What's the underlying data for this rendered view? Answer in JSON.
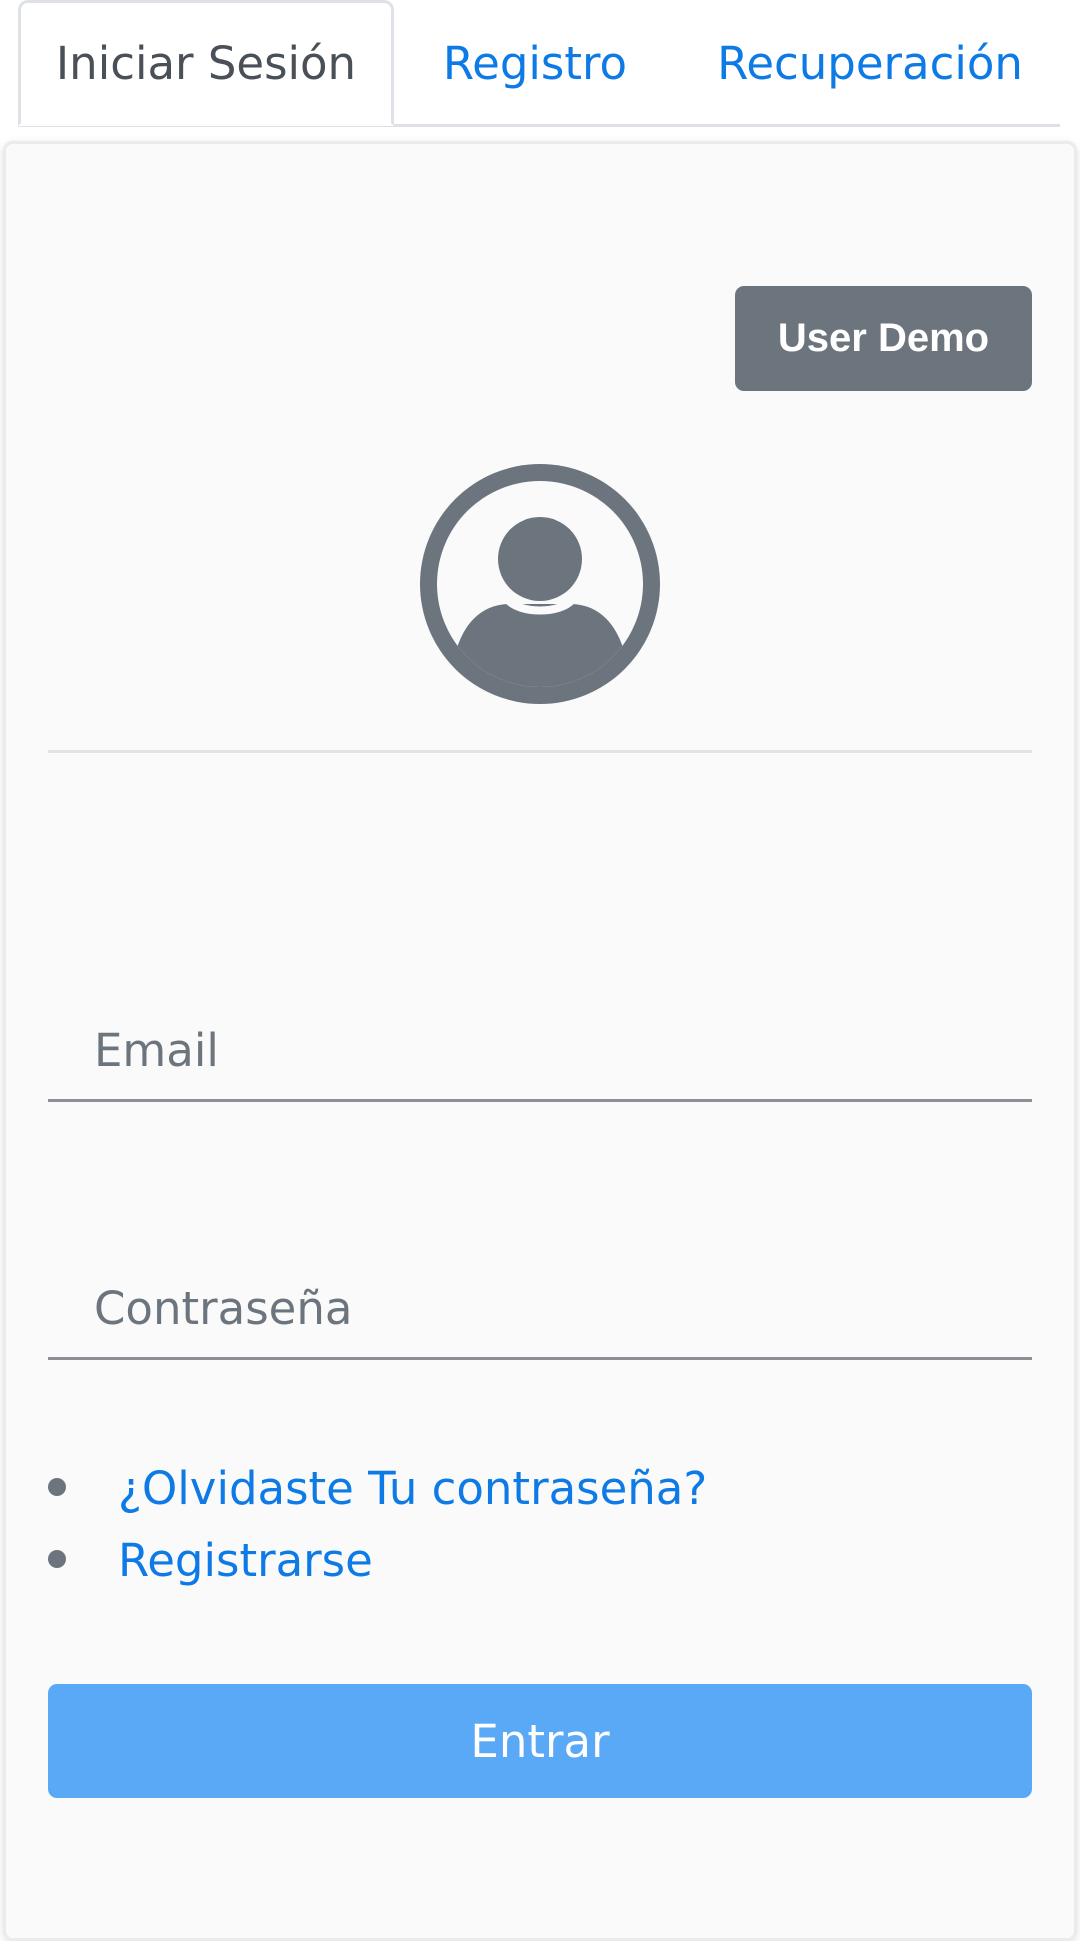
{
  "tabs": [
    {
      "label": "Iniciar Sesión",
      "active": true
    },
    {
      "label": "Registro",
      "active": false
    },
    {
      "label": "Recuperación",
      "active": false
    }
  ],
  "login": {
    "demo_button": "User Demo",
    "avatar_icon": "user-circle-icon",
    "email_placeholder": "Email",
    "password_placeholder": "Contraseña",
    "links": [
      {
        "label": "¿Olvidaste Tu contraseña?"
      },
      {
        "label": "Registrarse"
      }
    ],
    "submit_label": "Entrar"
  },
  "colors": {
    "link": "#0d7ae6",
    "secondary": "#6c757d",
    "primary_button": "#5aa9f7",
    "text": "#495057"
  }
}
